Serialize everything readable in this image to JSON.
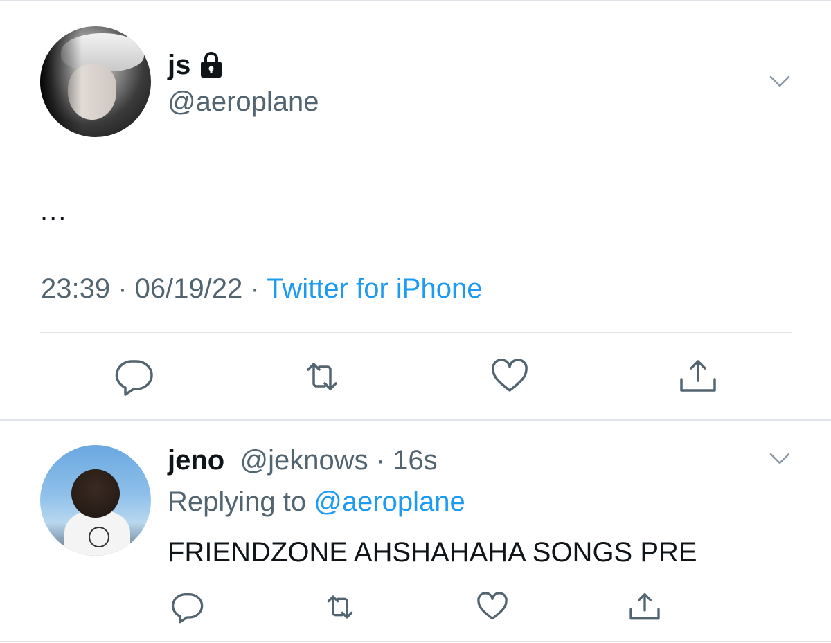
{
  "main_tweet": {
    "display_name": "js",
    "handle": "@aeroplane",
    "text": "...",
    "time": "23:39",
    "sep1": " · ",
    "date": "06/19/22",
    "sep2": " · ",
    "source": "Twitter for iPhone",
    "icons": [
      "lock-icon",
      "chevron-down-icon",
      "reply-icon",
      "retweet-icon",
      "like-icon",
      "share-icon"
    ]
  },
  "reply_tweet": {
    "display_name": "jeno",
    "handle": "@jeknows",
    "separator": " · ",
    "time_ago": "16s",
    "replying_to_label": "Replying to ",
    "replying_to_handle": "@aeroplane",
    "text": "FRIENDZONE AHSHAHAHA SONGS PRE"
  },
  "colors": {
    "accent": "#1d9bf0",
    "secondary_text": "#536471",
    "primary_text": "#0f1419",
    "divider": "#e1e5e9"
  }
}
